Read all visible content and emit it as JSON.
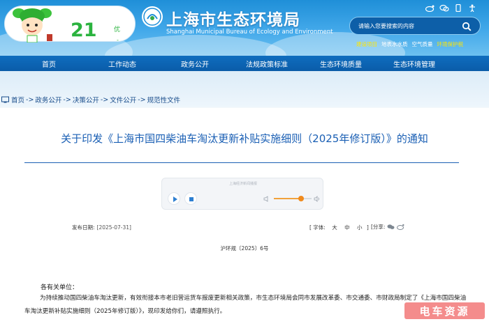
{
  "header": {
    "aqi": {
      "value": "21",
      "level": "优",
      "dash": "-",
      "level_color": "#2bb33f"
    },
    "site_title": "上海市生态环境局",
    "site_subtitle": "Shanghai Municipal Bureau of Ecology and Environment",
    "top_icons": [
      "weibo-icon",
      "wechat-icon",
      "app-icon",
      "accessibility-icon"
    ],
    "search": {
      "placeholder": "请输入您要搜索的内容"
    },
    "quick_links": [
      {
        "label": "建设项目",
        "highlight": true
      },
      {
        "label": "地表水水质",
        "highlight": false
      },
      {
        "label": "空气质量",
        "highlight": false
      },
      {
        "label": "环境保护税",
        "highlight": true
      }
    ]
  },
  "nav": {
    "items": [
      "首页",
      "工作动态",
      "政务公开",
      "法规政策标准",
      "生态环境质量",
      "生态环境管理"
    ]
  },
  "breadcrumb": {
    "items": [
      "首页",
      "政务公开",
      "决策公开",
      "文件公开",
      "规范性文件"
    ],
    "separator": "->"
  },
  "article": {
    "title": "关于印发《上海市国四柴油车淘汰更新补贴实施细则（2025年修订版）》的通知",
    "audio": {
      "label": "上海经济新闻播报",
      "volume": 0.72
    },
    "meta": {
      "date_label": "发布日期:",
      "date_value": "[2025-07-31]",
      "font_label": "[ 字体:",
      "font_sizes": [
        "大",
        "中",
        "小"
      ],
      "font_close": "]",
      "share_label": "[分享:"
    },
    "doc_number": "沪环规〔2025〕6号",
    "salutation": "各有关单位：",
    "body": "为持续推动国四柴油车淘汰更新，有效衔接本市老旧营运货车报废更新相关政策，市生态环境局会同市发展改革委、市交通委、市财政局制定了《上海市国四柴油车淘汰更新补贴实施细则（2025年修订版）》，现印发给你们，请遵照执行。"
  },
  "watermark": {
    "text": "电车资源"
  },
  "colors": {
    "header_blue": "#1f8fd8",
    "nav_blue": "#0a5ca8",
    "title_blue": "#1a5fb4",
    "accent_orange": "#f08a1c",
    "quick_link_highlight": "#ffe600"
  }
}
